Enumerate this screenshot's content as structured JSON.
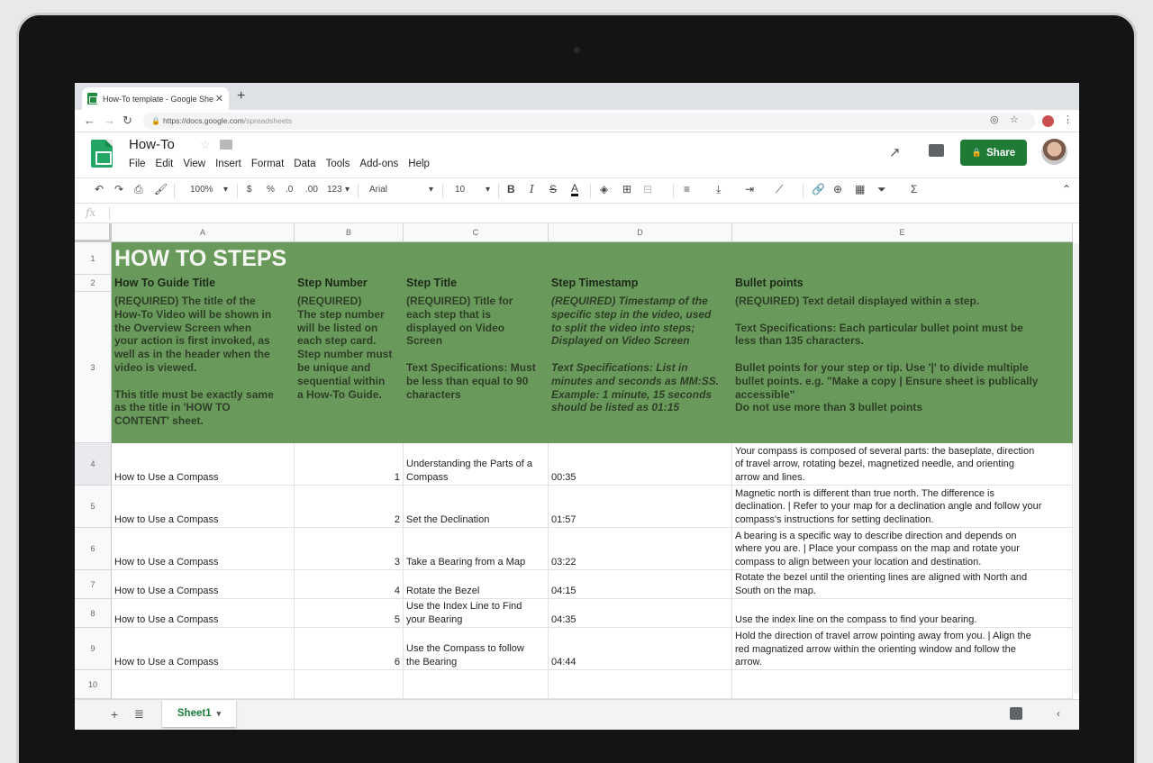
{
  "browser": {
    "tab_title": "How-To template - Google She",
    "url_host": "https://docs.google.com",
    "url_path": "/spreadsheets"
  },
  "doc": {
    "title": "How-To",
    "menu": [
      "File",
      "Edit",
      "View",
      "Insert",
      "Format",
      "Data",
      "Tools",
      "Add-ons",
      "Help"
    ],
    "share_label": "Share"
  },
  "toolbar": {
    "zoom": "100%",
    "currency": "$",
    "percent": "%",
    "dec_less": ".0",
    "dec_more": ".00",
    "more_formats": "123",
    "font": "Arial",
    "font_size": "10"
  },
  "formula_bar": {
    "fx": "fx"
  },
  "columns": [
    "A",
    "B",
    "C",
    "D",
    "E"
  ],
  "rows": [
    "1",
    "2",
    "3",
    "4",
    "5",
    "6",
    "7",
    "8",
    "9",
    "10"
  ],
  "sheet": {
    "title": "HOW TO STEPS",
    "headers": [
      "How To Guide Title",
      "Step Number",
      "Step Title",
      "Step Timestamp",
      "Bullet points"
    ],
    "descriptions": [
      [
        "(REQUIRED) The title of the",
        "How-To Video will be shown in",
        "the Overview Screen when",
        "your action is first invoked, as",
        "well as in the header when the",
        "video is viewed.",
        "",
        "This title must be exactly same",
        "as the title in 'HOW TO",
        "CONTENT' sheet."
      ],
      [
        "(REQUIRED)",
        "The step number",
        "will be listed on",
        "each step card.",
        "Step number must",
        "be unique and",
        "sequential within",
        "a How-To Guide."
      ],
      [
        "(REQUIRED) Title for",
        "each step that is",
        "displayed on Video",
        "Screen",
        "",
        "Text Specifications: Must",
        "be less than equal to 90",
        "characters"
      ],
      [
        "(REQUIRED) Timestamp of the",
        "specific step in the video, used",
        "to split the video into steps;",
        "Displayed on Video Screen",
        "",
        "Text Specifications: List in",
        "minutes and seconds as MM:SS.",
        "Example: 1 minute, 15 seconds",
        "should be listed as 01:15"
      ],
      [
        "(REQUIRED) Text detail displayed within a step.",
        "",
        "Text Specifications: Each particular bullet point must be",
        "less than 135 characters.",
        "",
        "Bullet points for your step or tip. Use '|' to divide multiple",
        "bullet points. e.g. \"Make a copy | Ensure sheet is publically",
        "accessible\"",
        "Do not use more than 3 bullet points"
      ]
    ],
    "data_rows": [
      {
        "guide": "How to Use a Compass",
        "step": "1",
        "title": [
          "Understanding the Parts of a",
          "Compass"
        ],
        "time": "00:35",
        "bullets": [
          "Your compass is composed of several parts: the baseplate, direction",
          "of travel arrow, rotating bezel, magnetized needle, and orienting",
          "arrow and lines."
        ]
      },
      {
        "guide": "How to Use a Compass",
        "step": "2",
        "title": [
          "Set the Declination"
        ],
        "time": "01:57",
        "bullets": [
          "Magnetic north is different than true north. The difference is",
          "declination. | Refer to your map for a declination angle and follow your",
          "compass's instructions for setting declination."
        ]
      },
      {
        "guide": "How to Use a Compass",
        "step": "3",
        "title": [
          "Take a Bearing from a Map"
        ],
        "time": "03:22",
        "bullets": [
          "A bearing is a specific way to describe direction and depends on",
          "where you are. | Place your compass on the map and rotate your",
          "compass to align between your location and destination."
        ]
      },
      {
        "guide": "How to Use a Compass",
        "step": "4",
        "title": [
          "Rotate the Bezel"
        ],
        "time": "04:15",
        "bullets": [
          "Rotate the bezel until the orienting lines are aligned with North and",
          "South on the map."
        ]
      },
      {
        "guide": "How to Use a Compass",
        "step": "5",
        "title": [
          "Use the Index Line to Find",
          "your Bearing"
        ],
        "time": "04:35",
        "bullets": [
          "Use the index line on the compass to find your bearing."
        ]
      },
      {
        "guide": "How to Use a Compass",
        "step": "6",
        "title": [
          "Use the Compass to follow",
          "the Bearing"
        ],
        "time": "04:44",
        "bullets": [
          "Hold the direction of travel arrow pointing away from you. | Align the",
          "red magnatized arrow within the orienting window and follow the",
          "arrow."
        ]
      }
    ]
  },
  "sheet_tabs": {
    "active": "Sheet1"
  },
  "colors": {
    "header_green": "#6a9a5b",
    "share_green": "#1f7a36",
    "tab_green": "#188038"
  }
}
